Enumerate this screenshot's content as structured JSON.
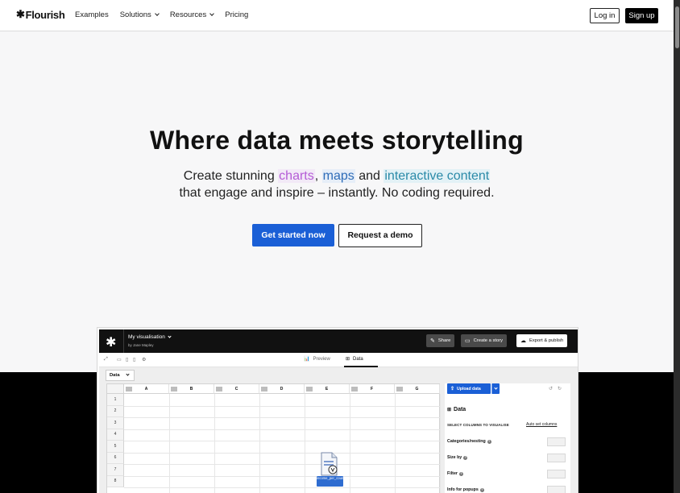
{
  "header": {
    "logo": "Flourish",
    "nav": [
      {
        "label": "Examples",
        "dropdown": false
      },
      {
        "label": "Solutions",
        "dropdown": true
      },
      {
        "label": "Resources",
        "dropdown": true
      },
      {
        "label": "Pricing",
        "dropdown": false
      }
    ],
    "login_label": "Log in",
    "signup_label": "Sign up"
  },
  "hero": {
    "title": "Where data meets storytelling",
    "sub_create": "Create stunning ",
    "sub_charts": "charts",
    "sub_comma": ", ",
    "sub_maps": "maps",
    "sub_and": " and ",
    "sub_interactive": "interactive content",
    "sub_line2": "that engage and inspire – instantly. No coding required.",
    "primary_cta": "Get started now",
    "secondary_cta": "Request a demo"
  },
  "app": {
    "vis_title": "My visualisation",
    "author": "by Jane Mapley",
    "share_label": "Share",
    "story_label": "Create a story",
    "export_label": "Export & publish",
    "tab_preview": "Preview",
    "tab_data": "Data",
    "sheet_tab": "Data",
    "columns": [
      "A",
      "B",
      "C",
      "D",
      "E",
      "F",
      "G"
    ],
    "rows": [
      "1",
      "2",
      "3",
      "4",
      "5",
      "6",
      "7",
      "8"
    ],
    "file_caption": "income_per_country.csv",
    "upload_label": "Upload data",
    "panel_title": "Data",
    "select_columns_label": "SELECT COLUMNS TO VISUALISE",
    "auto_set_label": "Auto set columns",
    "fields": [
      "Categories/nesting",
      "Size by",
      "Filter",
      "Info for popups"
    ]
  },
  "colors": {
    "primary_blue": "#1a5fd6",
    "charts_purple": "#b45bd6",
    "maps_blue": "#2e6cb8",
    "interactive_teal": "#2a8aa8"
  }
}
